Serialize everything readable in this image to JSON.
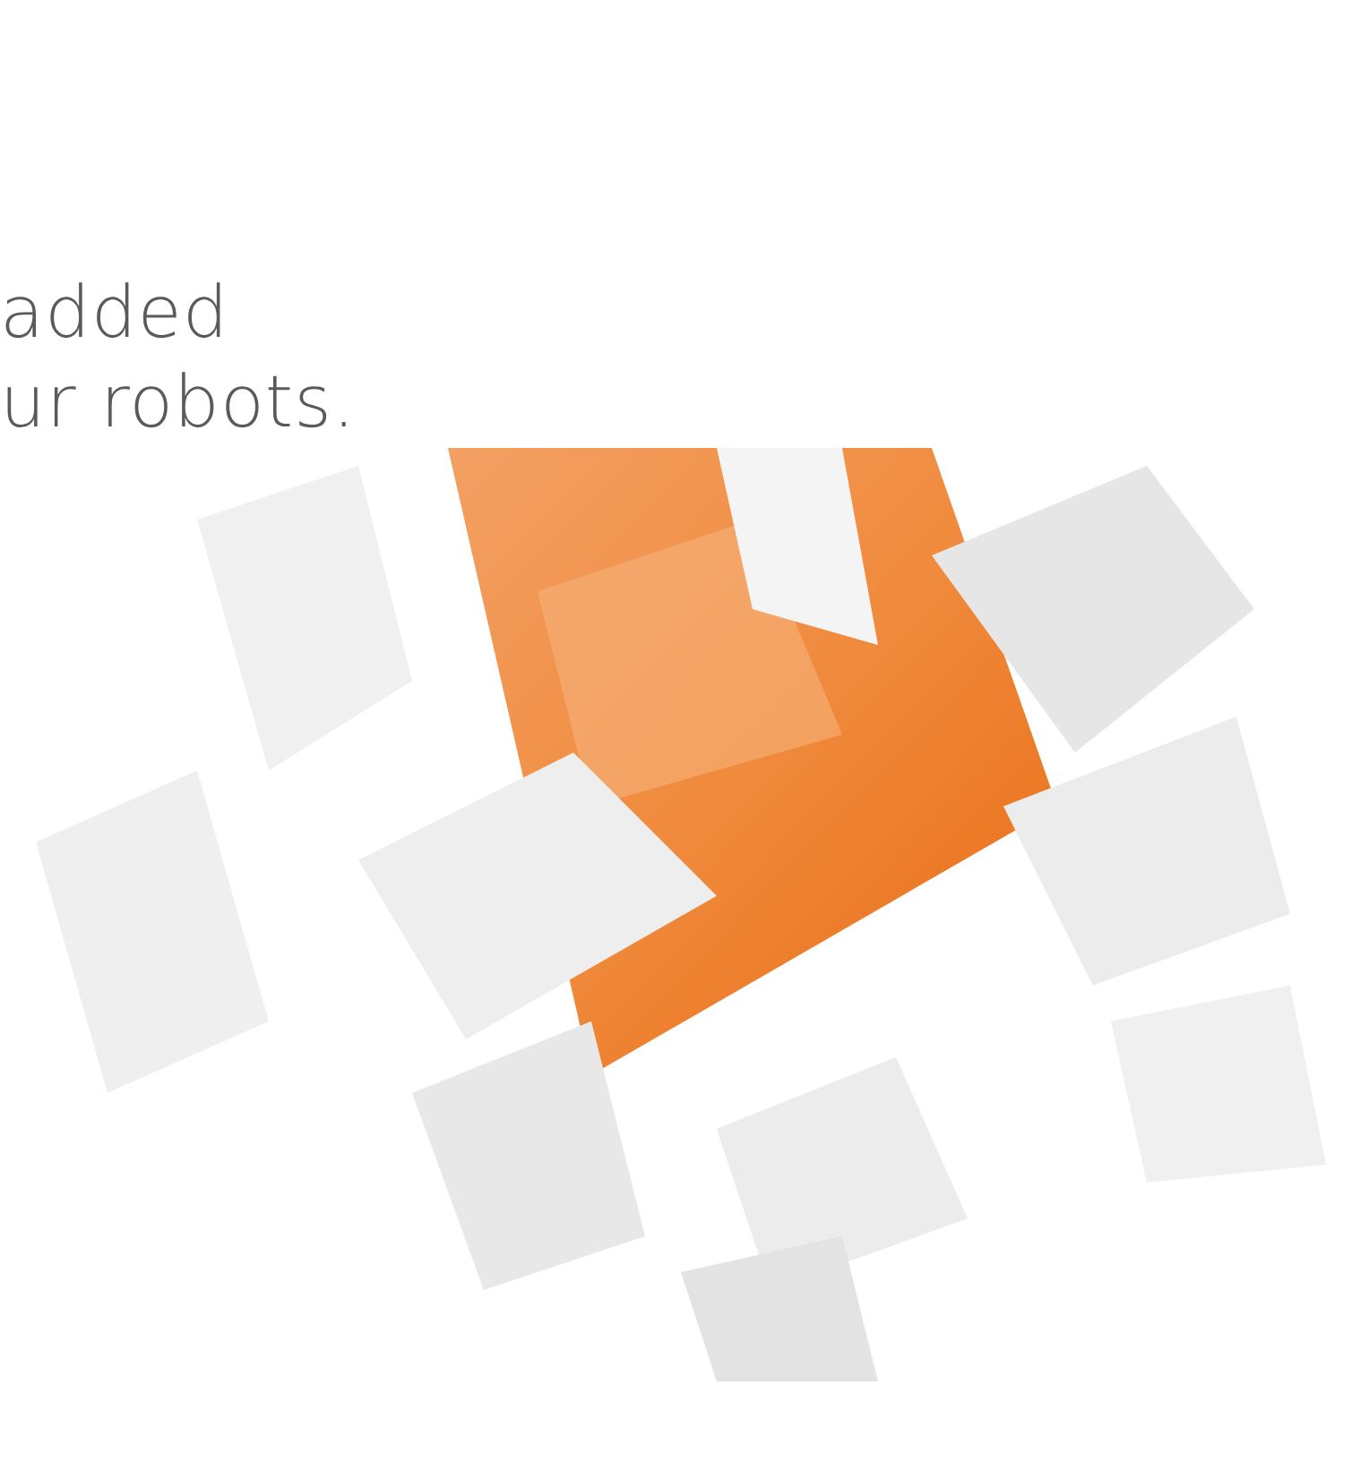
{
  "headline": {
    "lines": [
      "added",
      "ur robots."
    ]
  }
}
